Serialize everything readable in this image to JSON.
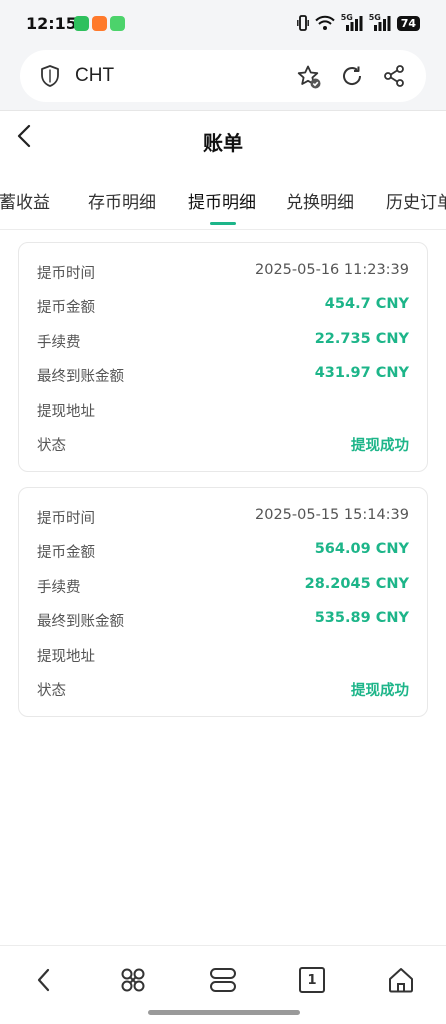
{
  "status_bar": {
    "time": "12:15",
    "battery": "74",
    "network_1": "5G",
    "network_2": "5G",
    "app_icons": [
      "wechat-icon",
      "taobao-icon",
      "messages-icon"
    ]
  },
  "browser": {
    "url": "CHT",
    "icons": [
      "shield-icon",
      "favorite-star-icon",
      "reload-icon",
      "share-icon"
    ]
  },
  "header": {
    "title": "账单"
  },
  "tabs": [
    {
      "label": "储蓄收益",
      "active": false
    },
    {
      "label": "存币明细",
      "active": false
    },
    {
      "label": "提币明细",
      "active": true
    },
    {
      "label": "兑换明细",
      "active": false
    },
    {
      "label": "历史订单",
      "active": false
    }
  ],
  "records": [
    {
      "rows": [
        {
          "label": "提币时间",
          "value": "2025-05-16 11:23:39"
        },
        {
          "label": "提币金额",
          "value": "454.7 CNY"
        },
        {
          "label": "手续费",
          "value": "22.735 CNY"
        },
        {
          "label": "最终到账金额",
          "value": "431.97 CNY"
        },
        {
          "label": "提现地址",
          "value": ""
        },
        {
          "label": "状态",
          "value": "提现成功"
        }
      ]
    },
    {
      "rows": [
        {
          "label": "提币时间",
          "value": "2025-05-15 15:14:39"
        },
        {
          "label": "提币金额",
          "value": "564.09 CNY"
        },
        {
          "label": "手续费",
          "value": "28.2045 CNY"
        },
        {
          "label": "最终到账金额",
          "value": "535.89 CNY"
        },
        {
          "label": "提现地址",
          "value": ""
        },
        {
          "label": "状态",
          "value": "提现成功"
        }
      ]
    }
  ],
  "bottom_nav": {
    "tab_count": "1",
    "icons": [
      "back-icon",
      "apps-icon",
      "tabs-switcher-icon",
      "tab-count-icon",
      "home-icon"
    ]
  },
  "colors": {
    "accent": "#1db589",
    "muted_text": "#555555",
    "background": "#f4f5f7"
  }
}
